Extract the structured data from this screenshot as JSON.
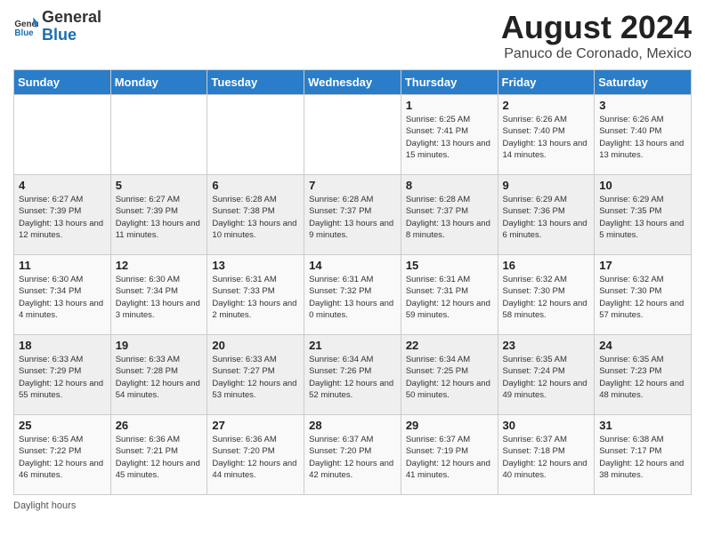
{
  "header": {
    "logo_general": "General",
    "logo_blue": "Blue",
    "title": "August 2024",
    "subtitle": "Panuco de Coronado, Mexico"
  },
  "days_of_week": [
    "Sunday",
    "Monday",
    "Tuesday",
    "Wednesday",
    "Thursday",
    "Friday",
    "Saturday"
  ],
  "footer": {
    "note": "Daylight hours"
  },
  "weeks": [
    [
      {
        "day": "",
        "sunrise": "",
        "sunset": "",
        "daylight": ""
      },
      {
        "day": "",
        "sunrise": "",
        "sunset": "",
        "daylight": ""
      },
      {
        "day": "",
        "sunrise": "",
        "sunset": "",
        "daylight": ""
      },
      {
        "day": "",
        "sunrise": "",
        "sunset": "",
        "daylight": ""
      },
      {
        "day": "1",
        "sunrise": "6:25 AM",
        "sunset": "7:41 PM",
        "daylight": "13 hours and 15 minutes."
      },
      {
        "day": "2",
        "sunrise": "6:26 AM",
        "sunset": "7:40 PM",
        "daylight": "13 hours and 14 minutes."
      },
      {
        "day": "3",
        "sunrise": "6:26 AM",
        "sunset": "7:40 PM",
        "daylight": "13 hours and 13 minutes."
      }
    ],
    [
      {
        "day": "4",
        "sunrise": "6:27 AM",
        "sunset": "7:39 PM",
        "daylight": "13 hours and 12 minutes."
      },
      {
        "day": "5",
        "sunrise": "6:27 AM",
        "sunset": "7:39 PM",
        "daylight": "13 hours and 11 minutes."
      },
      {
        "day": "6",
        "sunrise": "6:28 AM",
        "sunset": "7:38 PM",
        "daylight": "13 hours and 10 minutes."
      },
      {
        "day": "7",
        "sunrise": "6:28 AM",
        "sunset": "7:37 PM",
        "daylight": "13 hours and 9 minutes."
      },
      {
        "day": "8",
        "sunrise": "6:28 AM",
        "sunset": "7:37 PM",
        "daylight": "13 hours and 8 minutes."
      },
      {
        "day": "9",
        "sunrise": "6:29 AM",
        "sunset": "7:36 PM",
        "daylight": "13 hours and 6 minutes."
      },
      {
        "day": "10",
        "sunrise": "6:29 AM",
        "sunset": "7:35 PM",
        "daylight": "13 hours and 5 minutes."
      }
    ],
    [
      {
        "day": "11",
        "sunrise": "6:30 AM",
        "sunset": "7:34 PM",
        "daylight": "13 hours and 4 minutes."
      },
      {
        "day": "12",
        "sunrise": "6:30 AM",
        "sunset": "7:34 PM",
        "daylight": "13 hours and 3 minutes."
      },
      {
        "day": "13",
        "sunrise": "6:31 AM",
        "sunset": "7:33 PM",
        "daylight": "13 hours and 2 minutes."
      },
      {
        "day": "14",
        "sunrise": "6:31 AM",
        "sunset": "7:32 PM",
        "daylight": "13 hours and 0 minutes."
      },
      {
        "day": "15",
        "sunrise": "6:31 AM",
        "sunset": "7:31 PM",
        "daylight": "12 hours and 59 minutes."
      },
      {
        "day": "16",
        "sunrise": "6:32 AM",
        "sunset": "7:30 PM",
        "daylight": "12 hours and 58 minutes."
      },
      {
        "day": "17",
        "sunrise": "6:32 AM",
        "sunset": "7:30 PM",
        "daylight": "12 hours and 57 minutes."
      }
    ],
    [
      {
        "day": "18",
        "sunrise": "6:33 AM",
        "sunset": "7:29 PM",
        "daylight": "12 hours and 55 minutes."
      },
      {
        "day": "19",
        "sunrise": "6:33 AM",
        "sunset": "7:28 PM",
        "daylight": "12 hours and 54 minutes."
      },
      {
        "day": "20",
        "sunrise": "6:33 AM",
        "sunset": "7:27 PM",
        "daylight": "12 hours and 53 minutes."
      },
      {
        "day": "21",
        "sunrise": "6:34 AM",
        "sunset": "7:26 PM",
        "daylight": "12 hours and 52 minutes."
      },
      {
        "day": "22",
        "sunrise": "6:34 AM",
        "sunset": "7:25 PM",
        "daylight": "12 hours and 50 minutes."
      },
      {
        "day": "23",
        "sunrise": "6:35 AM",
        "sunset": "7:24 PM",
        "daylight": "12 hours and 49 minutes."
      },
      {
        "day": "24",
        "sunrise": "6:35 AM",
        "sunset": "7:23 PM",
        "daylight": "12 hours and 48 minutes."
      }
    ],
    [
      {
        "day": "25",
        "sunrise": "6:35 AM",
        "sunset": "7:22 PM",
        "daylight": "12 hours and 46 minutes."
      },
      {
        "day": "26",
        "sunrise": "6:36 AM",
        "sunset": "7:21 PM",
        "daylight": "12 hours and 45 minutes."
      },
      {
        "day": "27",
        "sunrise": "6:36 AM",
        "sunset": "7:20 PM",
        "daylight": "12 hours and 44 minutes."
      },
      {
        "day": "28",
        "sunrise": "6:37 AM",
        "sunset": "7:20 PM",
        "daylight": "12 hours and 42 minutes."
      },
      {
        "day": "29",
        "sunrise": "6:37 AM",
        "sunset": "7:19 PM",
        "daylight": "12 hours and 41 minutes."
      },
      {
        "day": "30",
        "sunrise": "6:37 AM",
        "sunset": "7:18 PM",
        "daylight": "12 hours and 40 minutes."
      },
      {
        "day": "31",
        "sunrise": "6:38 AM",
        "sunset": "7:17 PM",
        "daylight": "12 hours and 38 minutes."
      }
    ]
  ]
}
